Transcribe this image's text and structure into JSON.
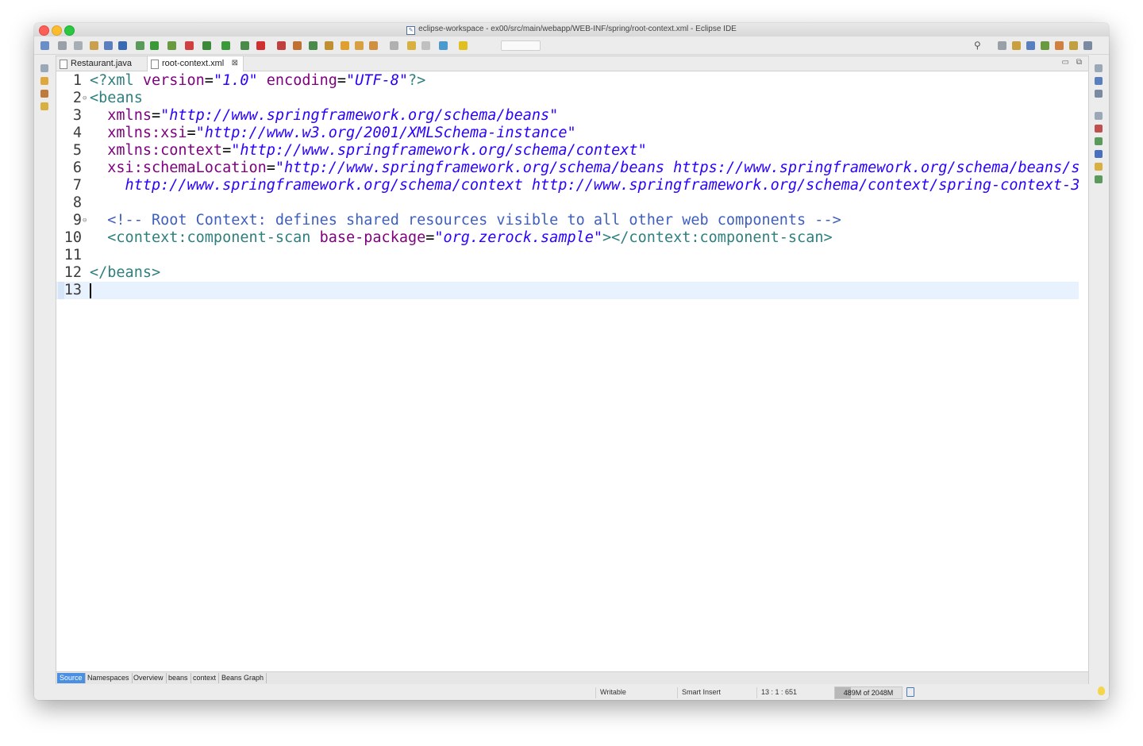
{
  "window": {
    "title": "eclipse-workspace - ex00/src/main/webapp/WEB-INF/spring/root-context.xml - Eclipse IDE"
  },
  "toolbar": {
    "icons": [
      "new-wizard-icon",
      "save-icon",
      "save-all-icon",
      "print-icon",
      "properties-icon",
      "open-type-icon",
      "open-task-icon",
      "skip-breakpoints-icon",
      "spring-boot-icon",
      "refresh-icon",
      "debug-icon",
      "run-icon",
      "coverage-icon",
      "stop-icon",
      "external-tools-icon",
      "new-project-icon",
      "new-class-icon",
      "new-package-icon",
      "open-folder-icon",
      "open-file-icon",
      "search-icon-tb",
      "annotation-icon",
      "back-icon",
      "forward-icon",
      "pin-icon",
      "mark-icon"
    ],
    "search_icon": "search-icon",
    "perspective_icons": [
      "perspective-open-icon",
      "java-ee-perspective-icon",
      "debug-perspective-icon",
      "spring-perspective-icon",
      "git-perspective-icon",
      "svn-perspective-icon",
      "resource-perspective-icon"
    ]
  },
  "tabs": [
    {
      "label": "Restaurant.java",
      "active": false
    },
    {
      "label": "root-context.xml",
      "active": true,
      "close": "⊠"
    }
  ],
  "editor": {
    "lines": [
      {
        "num": "1",
        "fold": ""
      },
      {
        "num": "2",
        "fold": "⊖"
      },
      {
        "num": "3",
        "fold": ""
      },
      {
        "num": "4",
        "fold": ""
      },
      {
        "num": "5",
        "fold": ""
      },
      {
        "num": "6",
        "fold": ""
      },
      {
        "num": "7",
        "fold": ""
      },
      {
        "num": "8",
        "fold": ""
      },
      {
        "num": "9",
        "fold": "⊖"
      },
      {
        "num": "10",
        "fold": ""
      },
      {
        "num": "11",
        "fold": ""
      },
      {
        "num": "12",
        "fold": ""
      },
      {
        "num": "13",
        "fold": ""
      }
    ],
    "code": {
      "l1": {
        "t1": "<?xml ",
        "a1": "version",
        "e1": "=",
        "v1": "\"1.0\"",
        "sp": " ",
        "a2": "encoding",
        "e2": "=",
        "v2": "\"UTF-8\"",
        "t2": "?>"
      },
      "l2": {
        "t1": "<beans"
      },
      "l3": {
        "a": "  xmlns",
        "e": "=",
        "v": "\"http://www.springframework.org/schema/beans\""
      },
      "l4": {
        "a": "  xmlns:xsi",
        "e": "=",
        "v": "\"http://www.w3.org/2001/XMLSchema-instance\""
      },
      "l5": {
        "a": "  xmlns:context",
        "e": "=",
        "v": "\"http://www.springframework.org/schema/context\""
      },
      "l6": {
        "a": "  xsi:schemaLocation",
        "e": "=",
        "v": "\"http://www.springframework.org/schema/beans https://www.springframework.org/schema/beans/s"
      },
      "l7": {
        "v": "    http://www.springframework.org/schema/context http://www.springframework.org/schema/context/spring-context-3"
      },
      "l9": {
        "c": "  <!-- Root Context: defines shared resources visible to all other web components -->"
      },
      "l10": {
        "t1": "  <context:component-scan ",
        "a": "base-package",
        "e": "=",
        "v": "\"org.zerock.sample\"",
        "t2": "></context:component-scan>"
      },
      "l12": {
        "t1": "</beans>"
      }
    }
  },
  "bottom_tabs": [
    "Source",
    "Namespaces",
    "Overview",
    "beans",
    "context",
    "Beans Graph"
  ],
  "status": {
    "writable": "Writable",
    "insert_mode": "Smart Insert",
    "position": "13 : 1 : 651",
    "heap": "489M of 2048M",
    "heap_fraction": 0.24
  },
  "colors": {
    "tag": "#2f7f7f",
    "attribute": "#7f007f",
    "value": "#2a00ff",
    "comment": "#3f5fbf",
    "current_line": "#e8f2fe",
    "active_bottom_tab": "#4a90e2"
  }
}
